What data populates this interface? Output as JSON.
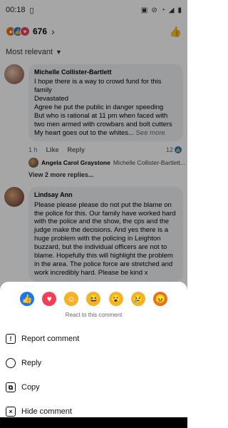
{
  "status": {
    "time": "00:18"
  },
  "post": {
    "reaction_count": "676"
  },
  "sort": {
    "label": "Most relevant"
  },
  "comments": [
    {
      "author": "Michelle Collister-Bartlett",
      "lines": [
        "I hope there is a way to crowd fund for this family",
        "Devastated",
        "Agree he put the public in danger speeding",
        "But who is rational at 11 pm when faced with two men armed with crowbars and bolt cutters",
        "My heart goes out to the whites..."
      ],
      "see_more": "See more",
      "time": "1 h",
      "like": "Like",
      "reply": "Reply",
      "reaction_count": "12",
      "reply_preview": {
        "author": "Angela Carol Graystone",
        "text": "Michelle Collister-Bartlett..."
      },
      "more_replies": "View 2 more replies..."
    },
    {
      "author": "Lindsay Ann",
      "text": "Please please please do not put the blame on the police for this. Our family have worked hard with the police and the show, the cps and the judge make the decisions. And yes there is a huge problem with the policing in Leighton buzzard, but the individual officers are not to blame. Hopefully this will highlight the problem in the area. The police force are stretched and work incredibly hard. Please be kind x"
    }
  ],
  "sheet": {
    "reactions": [
      "like",
      "love",
      "care",
      "haha",
      "wow",
      "sad",
      "angry"
    ],
    "label": "React to this comment",
    "items": [
      "Report comment",
      "Reply",
      "Copy",
      "Hide comment"
    ]
  }
}
